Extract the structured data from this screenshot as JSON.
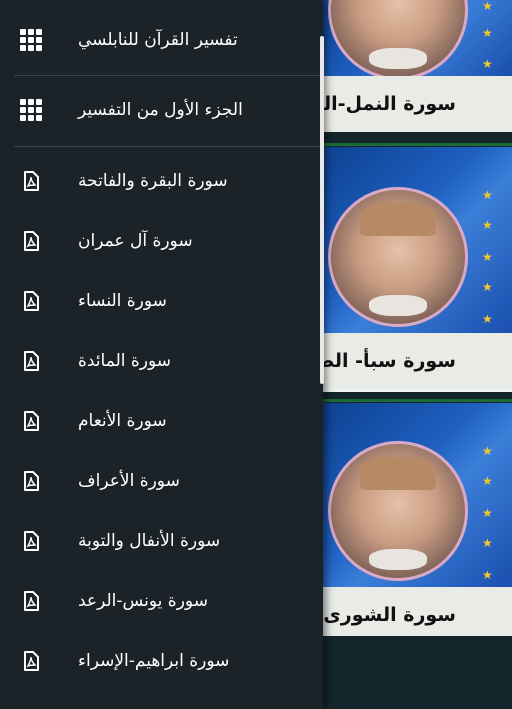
{
  "drawer": {
    "header_items": [
      {
        "label": "تفسير القرآن للنابلسي",
        "icon": "grid-icon"
      },
      {
        "label": "الجزء الأول من التفسير",
        "icon": "grid-icon"
      }
    ],
    "items": [
      {
        "label": "سورة البقرة والفاتحة",
        "icon": "pdf-icon"
      },
      {
        "label": "سورة آل عمران",
        "icon": "pdf-icon"
      },
      {
        "label": "سورة النساء",
        "icon": "pdf-icon"
      },
      {
        "label": "سورة المائدة",
        "icon": "pdf-icon"
      },
      {
        "label": "سورة الأنعام",
        "icon": "pdf-icon"
      },
      {
        "label": "سورة الأعراف",
        "icon": "pdf-icon"
      },
      {
        "label": "سورة الأنفال والتوبة",
        "icon": "pdf-icon"
      },
      {
        "label": "سورة يونس-الرعد",
        "icon": "pdf-icon"
      },
      {
        "label": "سورة ابراهيم-الإسراء",
        "icon": "pdf-icon"
      }
    ]
  },
  "background_cards": [
    {
      "title": "سورة النمل-العنكبوت"
    },
    {
      "title": "سورة سبأ- الصافات"
    },
    {
      "title": "سورة الشورى-الجاثية"
    }
  ],
  "colors": {
    "drawer_bg": "#1b2228",
    "text": "#ffffff",
    "banner_blue": "#1e5fc0",
    "star": "#f2c72a"
  }
}
